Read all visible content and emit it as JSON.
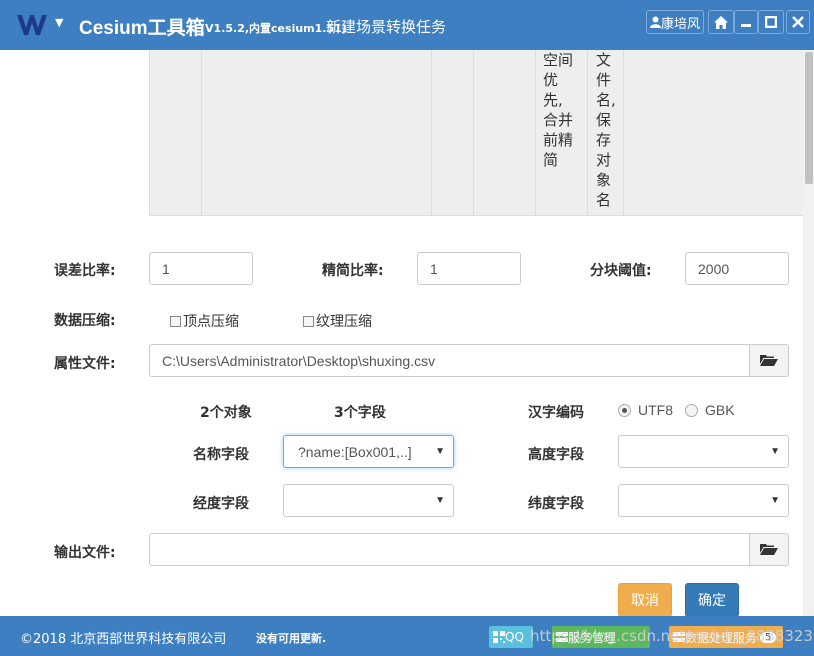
{
  "window": {
    "app_title": "Cesium工具箱",
    "version": "(V1.5.2,内置cesium1.51)",
    "task_title": "新建场景转换任务",
    "user_label": "康培风",
    "colors": {
      "titlebar": "#3d7fc1",
      "primary": "#337ab7",
      "warning": "#f0ad4e",
      "success": "#5cb85c",
      "info": "#5bc0de"
    }
  },
  "table_fragment": {
    "col5_text": "空间优先,合并前精简",
    "col6_text": "文件名,保存对象名"
  },
  "form": {
    "error_ratio_label": "误差比率:",
    "error_ratio_value": "1",
    "simplify_ratio_label": "精简比率:",
    "simplify_ratio_value": "1",
    "block_threshold_label": "分块阈值:",
    "block_threshold_value": "2000",
    "compress_label": "数据压缩:",
    "vertex_compress_label": "顶点压缩",
    "texture_compress_label": "纹理压缩",
    "attr_file_label": "属性文件:",
    "attr_file_value": "C:\\Users\\Administrator\\Desktop\\shuxing.csv",
    "object_count": "2个对象",
    "field_count": "3个字段",
    "encoding_label": "汉字编码",
    "encoding_utf8": "UTF8",
    "encoding_gbk": "GBK",
    "name_field_label": "名称字段",
    "name_field_value": "?name:[Box001,..]",
    "height_field_label": "高度字段",
    "height_field_value": "",
    "lon_field_label": "经度字段",
    "lon_field_value": "",
    "lat_field_label": "纬度字段",
    "lat_field_value": "",
    "output_file_label": "输出文件:",
    "output_file_value": "",
    "cancel_label": "取消",
    "ok_label": "确定"
  },
  "footer": {
    "copyright": "©2018 北京西部世界科技有限公司",
    "update_status": "没有可用更新.",
    "qq_label": "QQ",
    "service_label": "服务管理",
    "data_label": "数据处理服务",
    "data_badge": "5"
  },
  "watermark": "https://blog.csdn.net/weixin_38383235"
}
